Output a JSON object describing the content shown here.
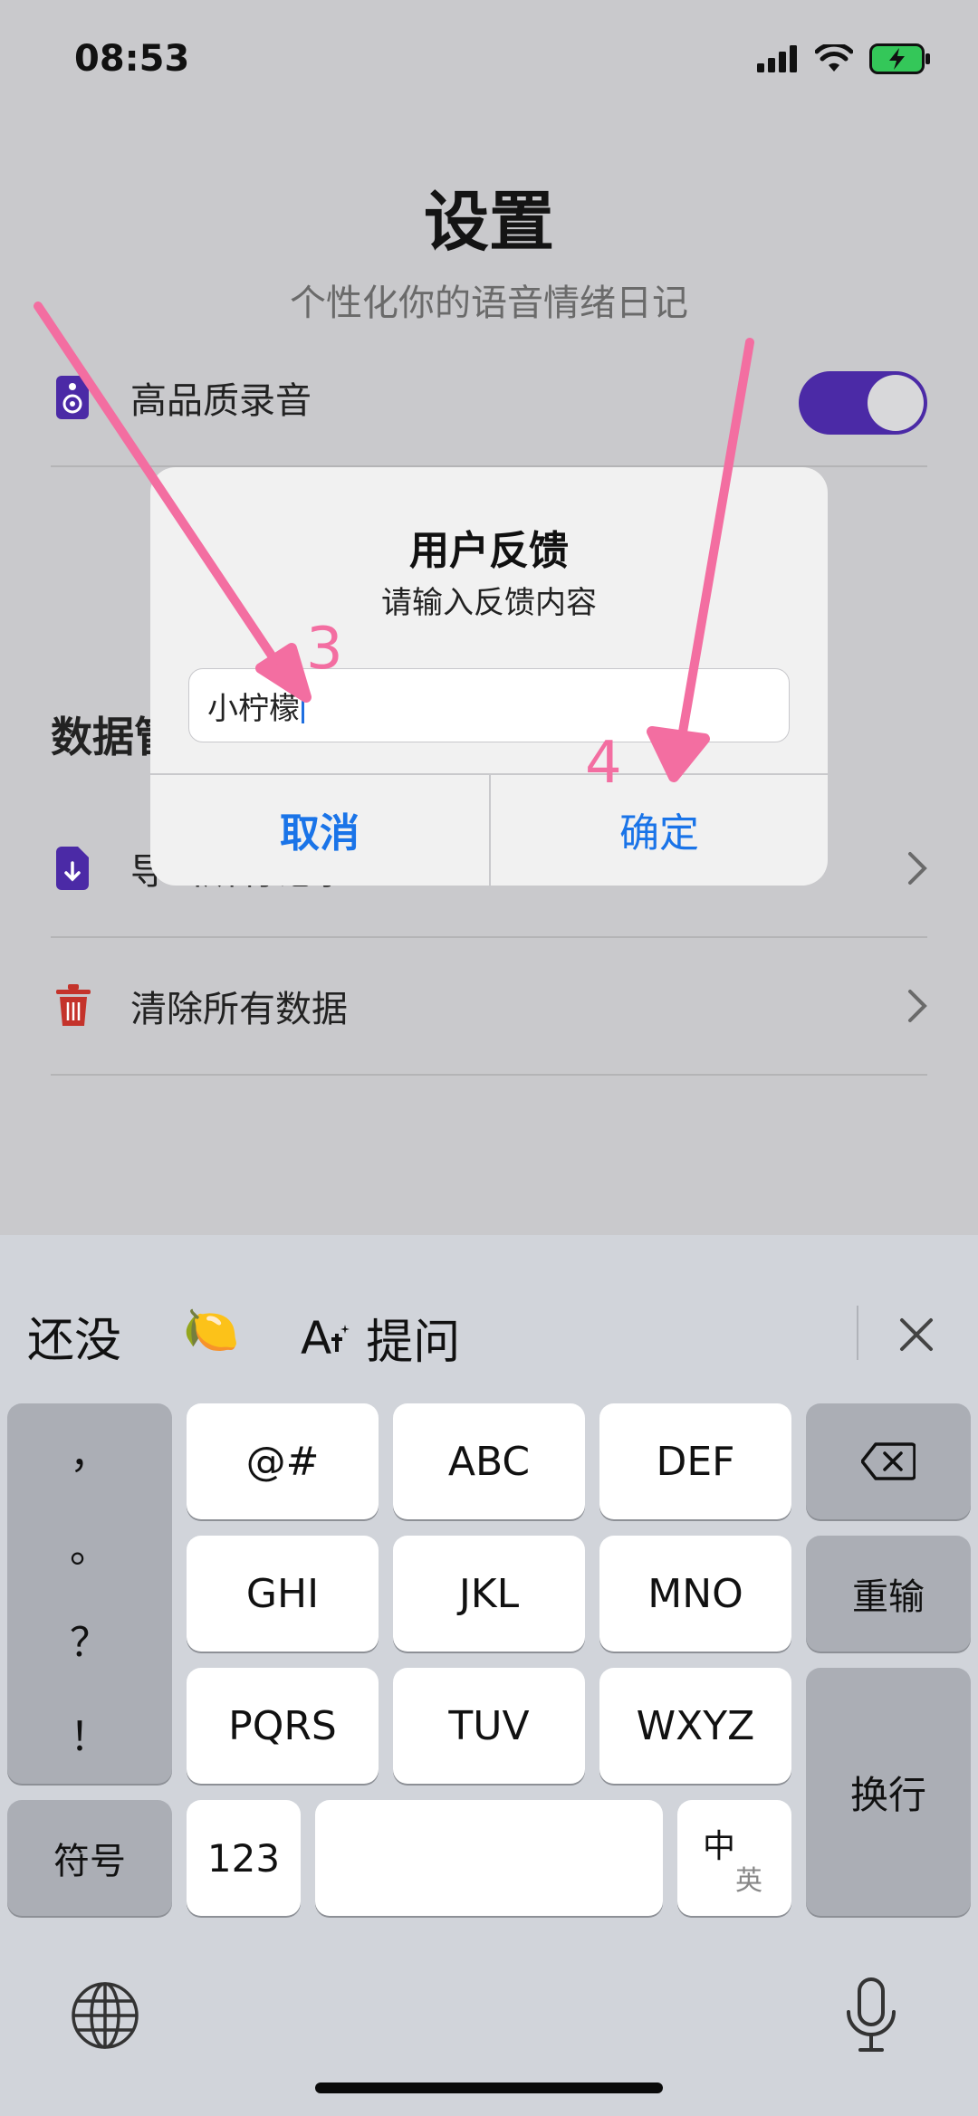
{
  "status": {
    "time": "08:53"
  },
  "header": {
    "title": "设置",
    "subtitle": "个性化你的语音情绪日记"
  },
  "rows": {
    "hq_recording": "高品质录音",
    "data_section": "数据管理",
    "export": "导出所有记录",
    "export_tail": "录",
    "clear": "清除所有数据"
  },
  "dialog": {
    "title": "用户反馈",
    "message": "请输入反馈内容",
    "input_value": "小柠檬",
    "cancel": "取消",
    "confirm": "确定"
  },
  "annotations": {
    "step3": "3",
    "step4": "4"
  },
  "keyboard": {
    "suggestions": [
      "还没",
      "🍋",
      "提问"
    ],
    "ai_label": "A",
    "punctuation": [
      "，",
      "。",
      "？",
      "！"
    ],
    "row1": [
      "@#",
      "ABC",
      "DEF"
    ],
    "row2": [
      "GHI",
      "JKL",
      "MNO"
    ],
    "row3": [
      "PQRS",
      "TUV",
      "WXYZ"
    ],
    "symbols": "符号",
    "num": "123",
    "lang_main": "中",
    "lang_sub": "英",
    "retype": "重输",
    "enter": "换行"
  },
  "colors": {
    "accent": "#4b2aa6",
    "link": "#1a74e8",
    "annotation": "#f36ea1",
    "danger": "#c4332b"
  }
}
